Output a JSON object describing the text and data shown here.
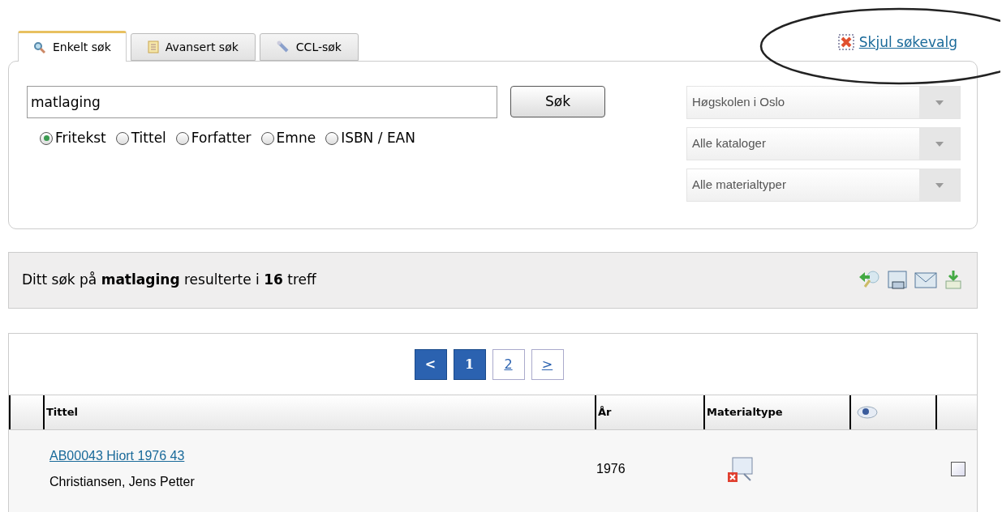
{
  "tabs": [
    {
      "label": "Enkelt søk",
      "selected": true
    },
    {
      "label": "Avansert søk",
      "selected": false
    },
    {
      "label": "CCL-søk",
      "selected": false
    }
  ],
  "hide_link": "Skjul søkevalg",
  "search": {
    "value": "matlaging",
    "button": "Søk"
  },
  "search_fields": [
    {
      "label": "Fritekst",
      "selected": true
    },
    {
      "label": "Tittel",
      "selected": false
    },
    {
      "label": "Forfatter",
      "selected": false
    },
    {
      "label": "Emne",
      "selected": false
    },
    {
      "label": "ISBN / EAN",
      "selected": false
    }
  ],
  "filters": [
    {
      "value": "Høgskolen i Oslo"
    },
    {
      "value": "Alle kataloger"
    },
    {
      "value": "Alle materialtyper"
    }
  ],
  "result_summary": "Ditt søk på **matlaging** resulterte i **16** treff",
  "pagination": [
    {
      "label": "<",
      "highlighted": true
    },
    {
      "label": "1",
      "highlighted": true
    },
    {
      "label": "2",
      "highlighted": false
    },
    {
      "label": ">",
      "highlighted": false
    }
  ],
  "table": {
    "columns": [
      "Tittel",
      "År",
      "Materialtype"
    ],
    "rows": [
      {
        "title": "AB00043 Hiort 1976 43",
        "author": "Christiansen, Jens Petter",
        "year": "1976",
        "checked": false
      }
    ]
  }
}
